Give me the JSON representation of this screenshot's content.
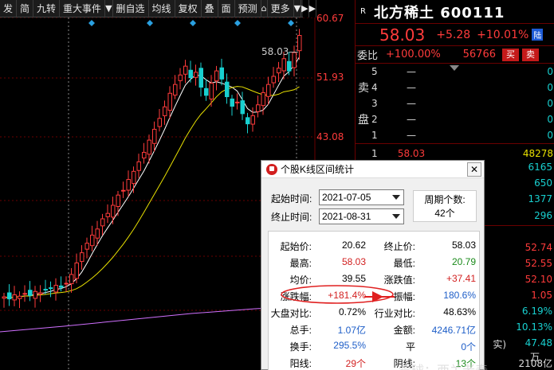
{
  "toolbar": {
    "items": [
      "发",
      "简",
      "九转",
      "重大事件",
      "删自选",
      "均线",
      "复权",
      "叠",
      "面",
      "预测",
      "更多"
    ]
  },
  "chart": {
    "price_labels": [
      "60.67",
      "51.93",
      "43.08"
    ],
    "last_price": "58.03"
  },
  "quote": {
    "badge": "R",
    "title": "北方稀土 600111",
    "price": "58.03",
    "change": "+5.28",
    "pct": "+10.01%",
    "tag": "陆",
    "ratio_label": "委比",
    "ratio_value": "+100.00%",
    "ratio_volume": "56766",
    "buy_label": "买",
    "sell_label": "卖",
    "ask_side_1": "卖",
    "ask_side_2": "盘",
    "asks": [
      {
        "level": "5",
        "price": "—",
        "vol": "0"
      },
      {
        "level": "4",
        "price": "—",
        "vol": "0"
      },
      {
        "level": "3",
        "price": "—",
        "vol": "0"
      },
      {
        "level": "2",
        "price": "—",
        "vol": "0"
      },
      {
        "level": "1",
        "price": "—",
        "vol": "0"
      }
    ],
    "bids": [
      {
        "level": "1",
        "price": "58.03",
        "vol": "48278"
      }
    ],
    "side_values": [
      "6165",
      "650",
      "1377",
      "296",
      "52.74",
      "52.55",
      "52.10",
      "1.05",
      "6.19%",
      "10.13%",
      "47.48"
    ],
    "side_partial": "实)",
    "side_bottom": "2108亿",
    "side_bottom2": "万"
  },
  "dialog": {
    "title": "个股K线区间统计",
    "start_label": "起始时间:",
    "start_value": "2021-07-05",
    "end_label": "终止时间:",
    "end_value": "2021-08-31",
    "count_label": "周期个数:",
    "count_value": "42个",
    "stats": [
      {
        "label": "起始价:",
        "value": "20.62",
        "color": "black",
        "label2": "终止价:",
        "value2": "58.03",
        "color2": "black"
      },
      {
        "label": "最高:",
        "value": "58.03",
        "color": "red",
        "label2": "最低:",
        "value2": "20.79",
        "color2": "green"
      },
      {
        "label": "均价:",
        "value": "39.55",
        "color": "black",
        "label2": "涨跌值:",
        "value2": "+37.41",
        "color2": "red"
      },
      {
        "label": "涨跌幅:",
        "value": "+181.4%",
        "color": "red",
        "label2": "振幅:",
        "value2": "180.6%",
        "color2": "blue"
      },
      {
        "label": "大盘对比:",
        "value": "0.72%",
        "color": "black",
        "label2": "行业对比:",
        "value2": "48.63%",
        "color2": "black"
      },
      {
        "label": "总手:",
        "value": "1.07亿",
        "color": "blue",
        "label2": "金额:",
        "value2": "4246.71亿",
        "color2": "blue"
      },
      {
        "label": "换手:",
        "value": "295.5%",
        "color": "blue",
        "label2": "平",
        "value2": "0个",
        "color2": "blue"
      },
      {
        "label": "阳线:",
        "value": "29个",
        "color": "red",
        "label2": "阴线:",
        "value2": "13个",
        "color2": "green"
      }
    ]
  },
  "watermark": "雪球：西关老泰",
  "colors": {
    "up": "#ff3b3b",
    "down": "#18d0d0",
    "ma5": "#ffffff",
    "ma10": "#e8e000",
    "ma20": "#d070ff"
  }
}
